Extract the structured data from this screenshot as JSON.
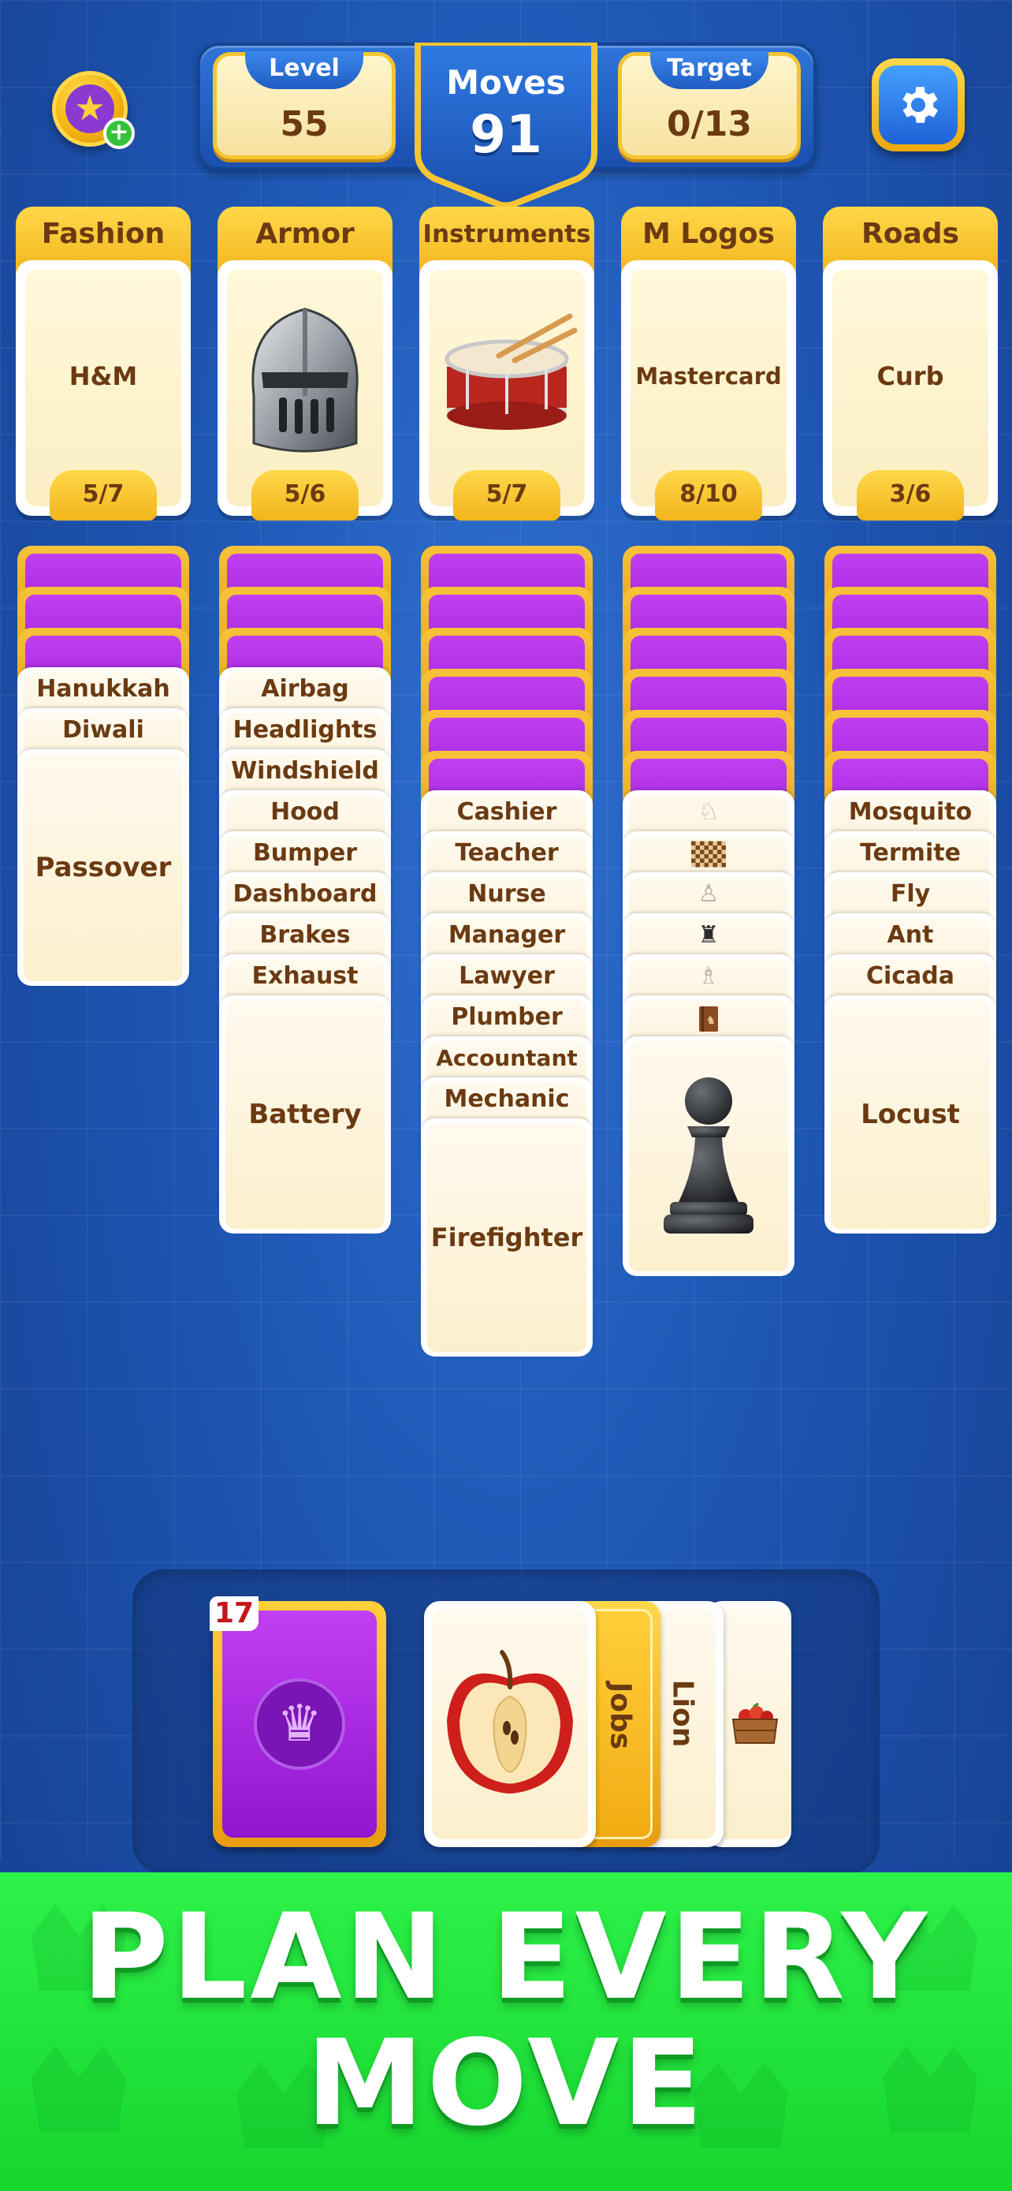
{
  "hud": {
    "level_label": "Level",
    "level_value": "55",
    "moves_label": "Moves",
    "moves_value": "91",
    "target_label": "Target",
    "target_value": "0/13",
    "coin_icon": "star-coin-icon",
    "settings_icon": "gear-icon"
  },
  "categories": [
    {
      "title": "Fashion",
      "card": "H&M",
      "count": "5/7"
    },
    {
      "title": "Armor",
      "card": "",
      "image": "knight-helmet-icon",
      "count": "5/6"
    },
    {
      "title": "Instruments",
      "card": "",
      "image": "drum-icon",
      "count": "5/7"
    },
    {
      "title": "M Logos",
      "card": "Mastercard",
      "count": "8/10"
    },
    {
      "title": "Roads",
      "card": "Curb",
      "count": "3/6"
    }
  ],
  "columns": [
    {
      "hidden": 3,
      "cards": [
        "Hanukkah",
        "Diwali"
      ],
      "top": "Passover"
    },
    {
      "hidden": 3,
      "cards": [
        "Airbag",
        "Headlights",
        "Windshield",
        "Hood",
        "Bumper",
        "Dashboard",
        "Brakes",
        "Exhaust"
      ],
      "top": "Battery"
    },
    {
      "hidden": 6,
      "cards": [
        "Cashier",
        "Teacher",
        "Nurse",
        "Manager",
        "Lawyer",
        "Plumber",
        "Accountant",
        "Mechanic"
      ],
      "top": "Firefighter"
    },
    {
      "hidden": 6,
      "cards": [
        "white-knight-icon",
        "chessboard-icon",
        "white-pawn-icon",
        "black-rook-icon",
        "white-bishop-icon",
        "chess-book-icon"
      ],
      "top": "black-pawn-icon"
    },
    {
      "hidden": 6,
      "cards": [
        "Mosquito",
        "Termite",
        "Fly",
        "Ant",
        "Cicada"
      ],
      "top": "Locust"
    }
  ],
  "deck": {
    "count": "17",
    "icon": "crown-icon"
  },
  "hand": [
    {
      "type": "image",
      "icon": "apple-icon"
    },
    {
      "type": "category",
      "label": "Jobs"
    },
    {
      "type": "word",
      "label": "Lion"
    },
    {
      "type": "image",
      "icon": "fruit-crate-icon"
    }
  ],
  "banner": {
    "line1": "PLAN EVERY",
    "line2": "MOVE"
  },
  "colors": {
    "background": "#1e56b3",
    "gold": "#f2b51c",
    "purple": "#9b1fd9",
    "banner_green": "#1fe03a",
    "text_brown": "#6b3a12"
  }
}
